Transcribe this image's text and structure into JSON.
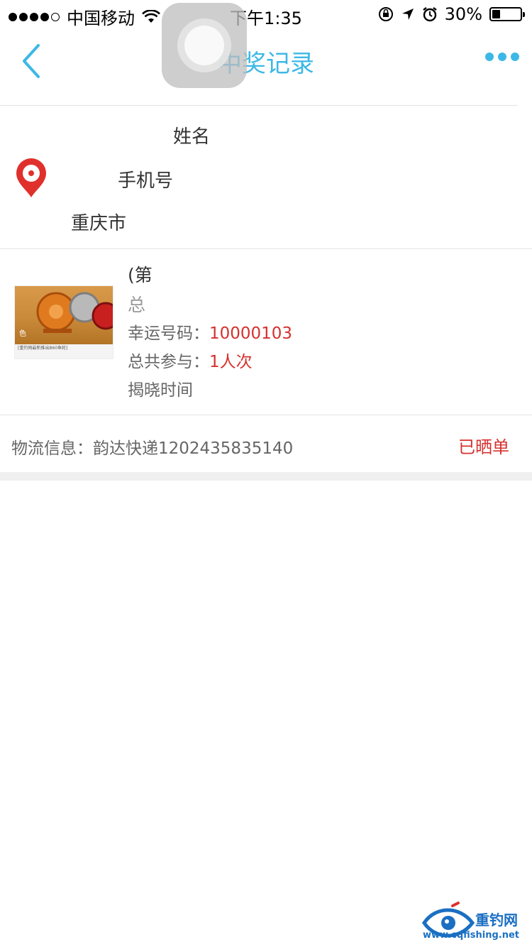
{
  "status_bar": {
    "carrier": "中国移动",
    "time": "下午1:35",
    "battery_percent": "30%",
    "battery_level": 0.3,
    "signal_bars_filled": 4,
    "signal_bars_total": 5
  },
  "nav": {
    "title": "中奖记录",
    "accent_color": "#3db8e6"
  },
  "address": {
    "name_label": "姓名",
    "phone_label": "手机号",
    "address_line": "重庆市"
  },
  "prize": {
    "title_prefix": "(第",
    "total_prefix": "总",
    "lucky_label": "幸运号码：",
    "lucky_value": "10000103",
    "participation_label": "总共参与：",
    "participation_value": "1人次",
    "reveal_time_label": "揭晓时间"
  },
  "thumbnail": {
    "badge": "色",
    "caption": "[重钓网最新推出B60鱼轮]"
  },
  "logistics": {
    "label": "物流信息：",
    "value": "韵达快递1202435835140",
    "status": "已晒单"
  },
  "watermark": {
    "brand": "重钓网",
    "url": "www.cqfishing.net"
  }
}
